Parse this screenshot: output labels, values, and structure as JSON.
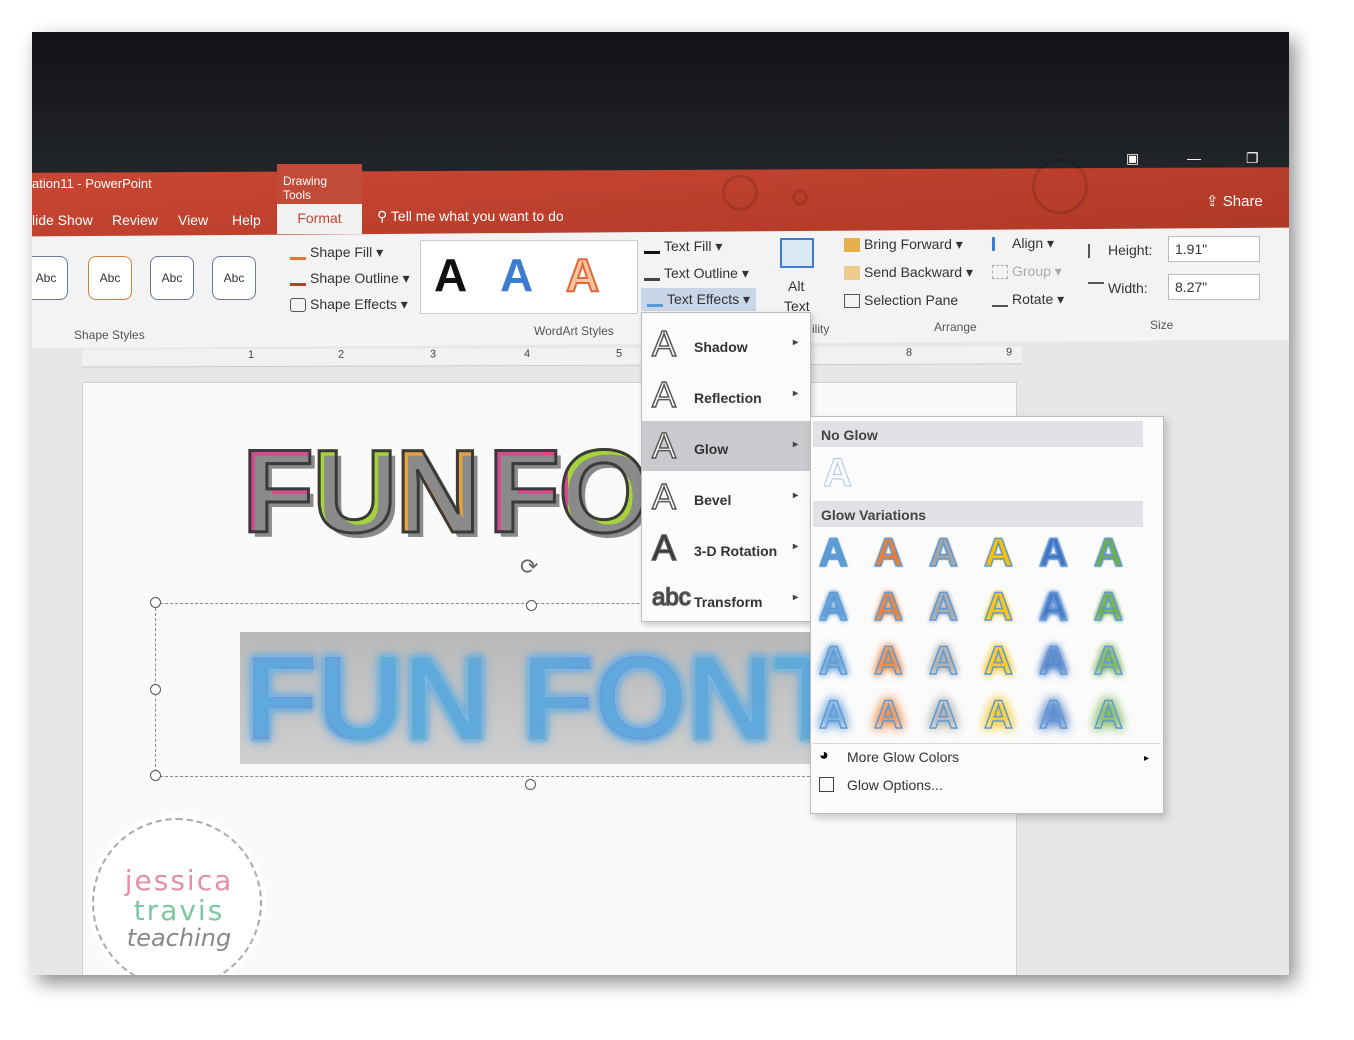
{
  "window": {
    "title": "ation11  -  PowerPoint",
    "context_tab": "Drawing Tools",
    "share": "Share"
  },
  "tabs": {
    "slide_show": "lide Show",
    "review": "Review",
    "view": "View",
    "help": "Help",
    "format": "Format"
  },
  "tell_me": "Tell me what you want to do",
  "shape_styles": {
    "thumb_label": "Abc",
    "fill": "Shape Fill",
    "outline": "Shape Outline",
    "effects": "Shape Effects",
    "group": "Shape Styles"
  },
  "wordart": {
    "glyph": "A",
    "text_fill": "Text Fill",
    "text_outline": "Text Outline",
    "text_effects": "Text Effects",
    "group": "WordArt Styles"
  },
  "accessibility": {
    "alt_line1": "Alt",
    "alt_line2": "Text",
    "group_fragment": "ility"
  },
  "arrange": {
    "bring_forward": "Bring Forward",
    "send_backward": "Send Backward",
    "selection_pane": "Selection Pane",
    "align": "Align",
    "group": "Group",
    "rotate": "Rotate",
    "label": "Arrange"
  },
  "size": {
    "height_label": "Height:",
    "height_value": "1.91\"",
    "width_label": "Width:",
    "width_value": "8.27\"",
    "label": "Size"
  },
  "ruler": {
    "marks": [
      "1",
      "2",
      "3",
      "4",
      "5",
      "8",
      "9"
    ]
  },
  "slide": {
    "text_top_1": "FUN",
    "text_top_2": "FO",
    "text_bottom": "FUN FONTS"
  },
  "text_effects_menu": {
    "items": [
      {
        "label": "Shadow",
        "glyph": "A"
      },
      {
        "label": "Reflection",
        "glyph": "A"
      },
      {
        "label": "Glow",
        "glyph": "A"
      },
      {
        "label": "Bevel",
        "glyph": "A"
      },
      {
        "label": "3-D Rotation",
        "glyph": "A"
      },
      {
        "label": "Transform",
        "glyph": "abc"
      }
    ]
  },
  "glow_menu": {
    "no_glow": "No Glow",
    "variations": "Glow Variations",
    "more_colors": "More Glow Colors",
    "options": "Glow Options...",
    "glow_colors": [
      "#5b9bd5",
      "#ed7d31",
      "#a5a5a5",
      "#ffc000",
      "#4472c4",
      "#70ad47"
    ]
  },
  "badge": {
    "line1": "jessica",
    "line2": "travis",
    "line3": "teaching"
  },
  "colors": {
    "accent": "#c4432f",
    "pink": "#d8488c",
    "green": "#a6d23c",
    "orange": "#e8a23c"
  }
}
